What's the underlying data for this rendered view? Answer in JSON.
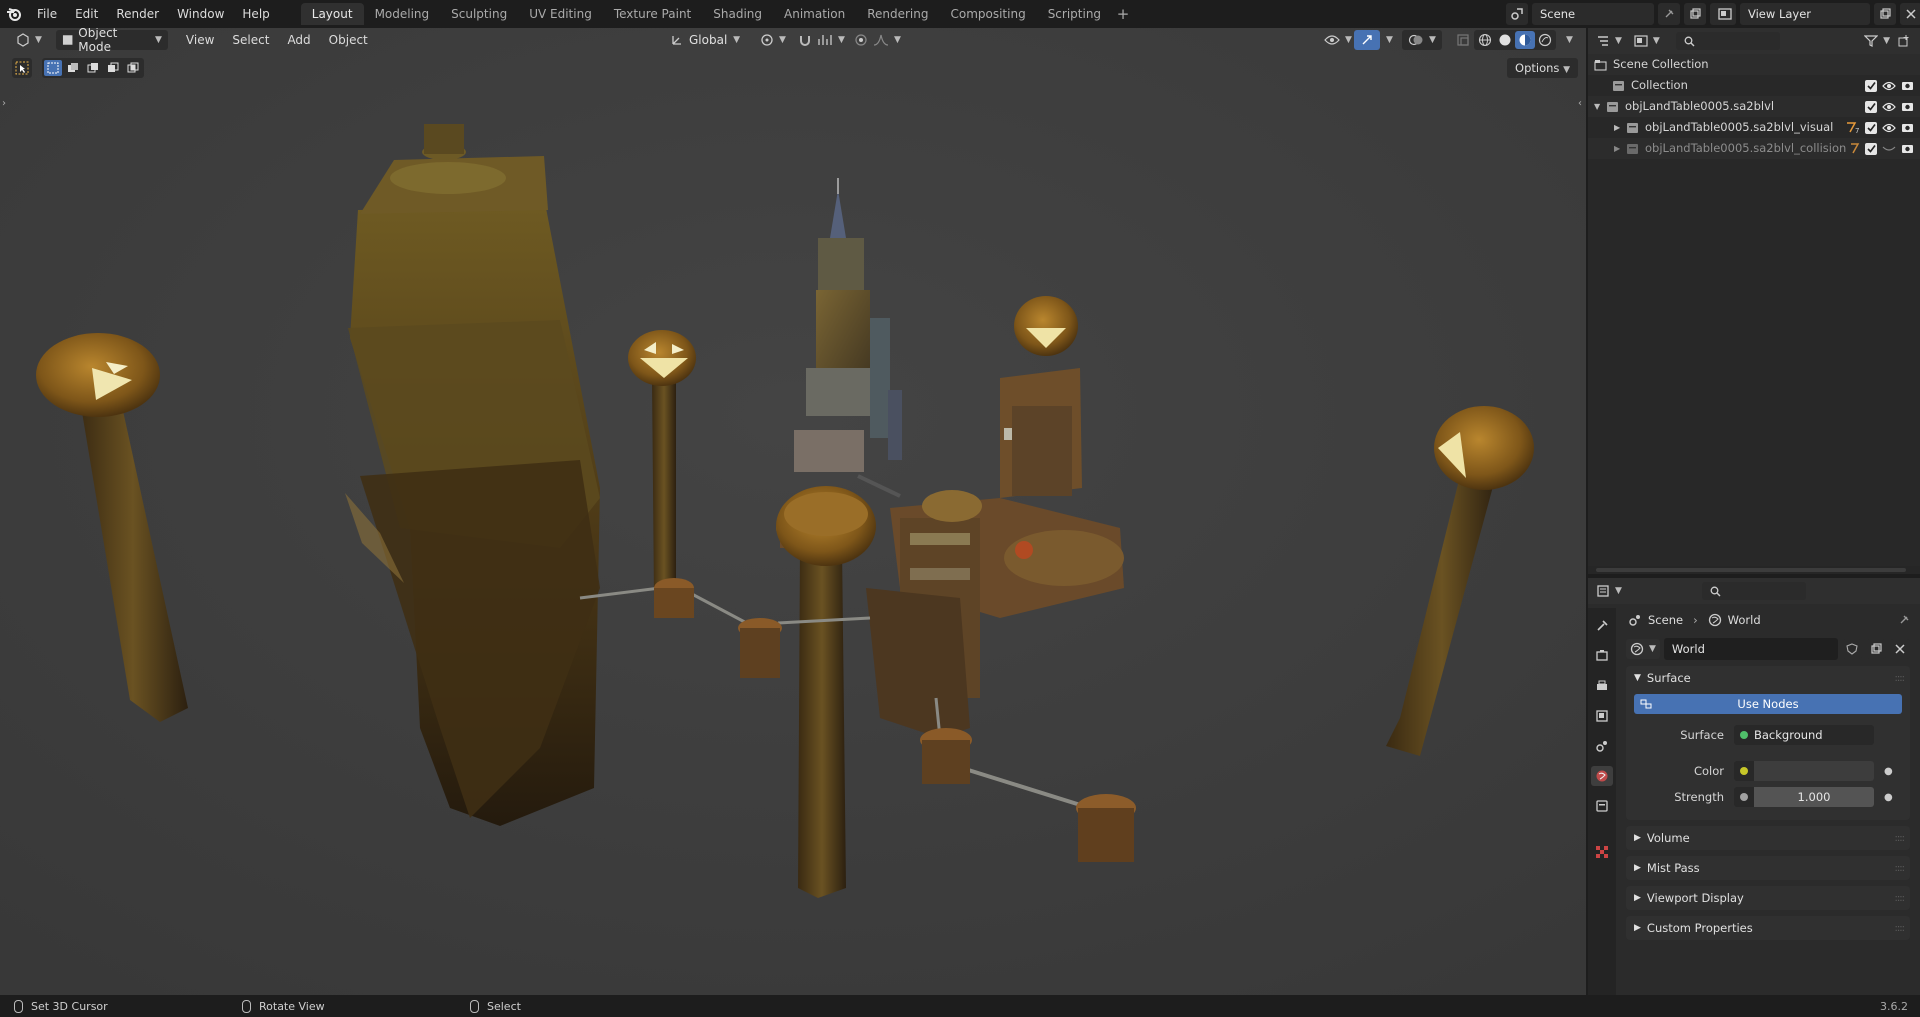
{
  "app": {
    "menus": [
      "File",
      "Edit",
      "Render",
      "Window",
      "Help"
    ],
    "workspaces": [
      "Layout",
      "Modeling",
      "Sculpting",
      "UV Editing",
      "Texture Paint",
      "Shading",
      "Animation",
      "Rendering",
      "Compositing",
      "Scripting"
    ],
    "active_workspace": "Layout",
    "scene_name": "Scene",
    "view_layer": "View Layer",
    "icons": {
      "logo": "blender-logo-icon",
      "add_workspace": "plus-icon"
    }
  },
  "viewport": {
    "mode": "Object Mode",
    "menus": [
      "View",
      "Select",
      "Add",
      "Object"
    ],
    "orientation": "Global",
    "options_label": "Options",
    "background_color": "#3d3d3d",
    "shading_active": "solid"
  },
  "outliner": {
    "root": "Scene Collection",
    "items": [
      {
        "label": "Collection",
        "dim": false
      },
      {
        "label": "objLandTable0005.sa2blvl",
        "dim": false
      },
      {
        "label": "objLandTable0005.sa2blvl_visual",
        "dim": false
      },
      {
        "label": "objLandTable0005.sa2blvl_collision",
        "dim": true
      }
    ]
  },
  "properties": {
    "breadcrumb": [
      "Scene",
      "World"
    ],
    "datablock": "World",
    "sections": {
      "surface": "Surface",
      "volume": "Volume",
      "mist": "Mist Pass",
      "viewport_display": "Viewport Display",
      "custom": "Custom Properties"
    },
    "use_nodes_label": "Use Nodes",
    "surface_label": "Surface",
    "surface_value": "Background",
    "color_label": "Color",
    "color_value": "#3d3d3d",
    "strength_label": "Strength",
    "strength_value": "1.000",
    "accent": "#4772b3"
  },
  "statusbar": {
    "items": [
      "Set 3D Cursor",
      "Rotate View",
      "Select"
    ],
    "version": "3.6.2"
  }
}
